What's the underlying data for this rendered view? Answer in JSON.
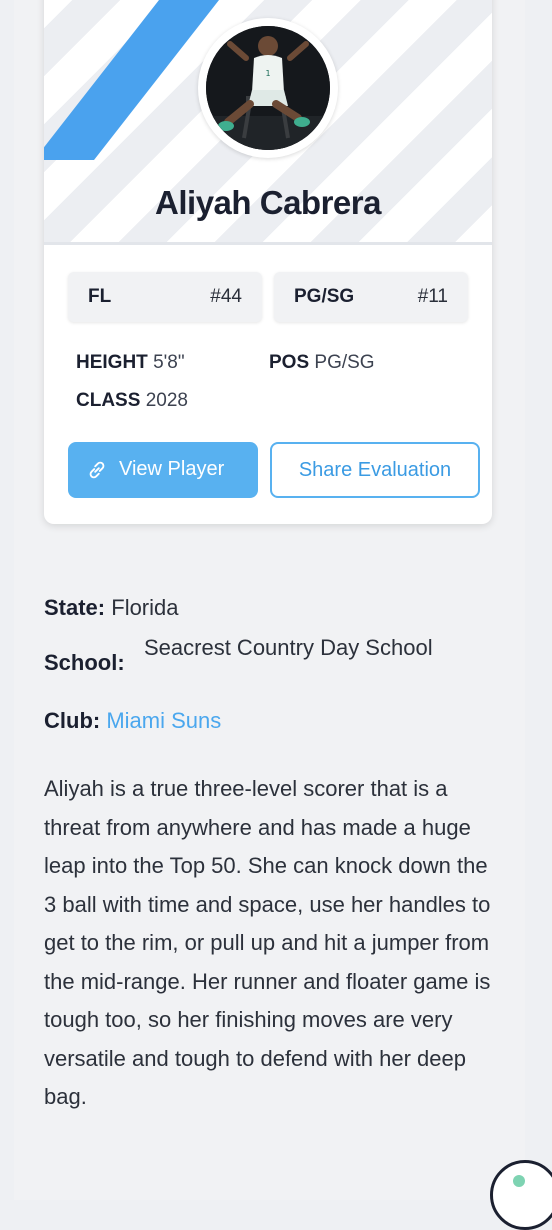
{
  "player": {
    "name": "Aliyah Cabrera",
    "avatar_icon": "player-photo",
    "chips": [
      {
        "left": "FL",
        "right": "#44"
      },
      {
        "left": "PG/SG",
        "right": "#11"
      }
    ],
    "stats": {
      "height_label": "HEIGHT",
      "height_value": "5'8\"",
      "pos_label": "POS",
      "pos_value": "PG/SG",
      "class_label": "CLASS",
      "class_value": "2028"
    },
    "buttons": {
      "view_label": "View Player",
      "share_label": "Share Evaluation"
    }
  },
  "details": {
    "state_label": "State:",
    "state_value": "Florida",
    "school_label": "School:",
    "school_value": "Seacrest Country Day School",
    "club_label": "Club:",
    "club_value": "Miami Suns"
  },
  "bio": "Aliyah is a true three-level scorer that is a threat from anywhere and has made a huge leap into the Top 50. She can knock down the 3 ball with time and space, use her handles to get to the rim, or pull up and hit a jumper from the mid-range. Her runner and floater game is tough too, so her finishing moves are very versatile and tough to defend with her deep bag.",
  "colors": {
    "accent": "#58b1f0",
    "link": "#4aa7ee",
    "text": "#1b2030"
  }
}
